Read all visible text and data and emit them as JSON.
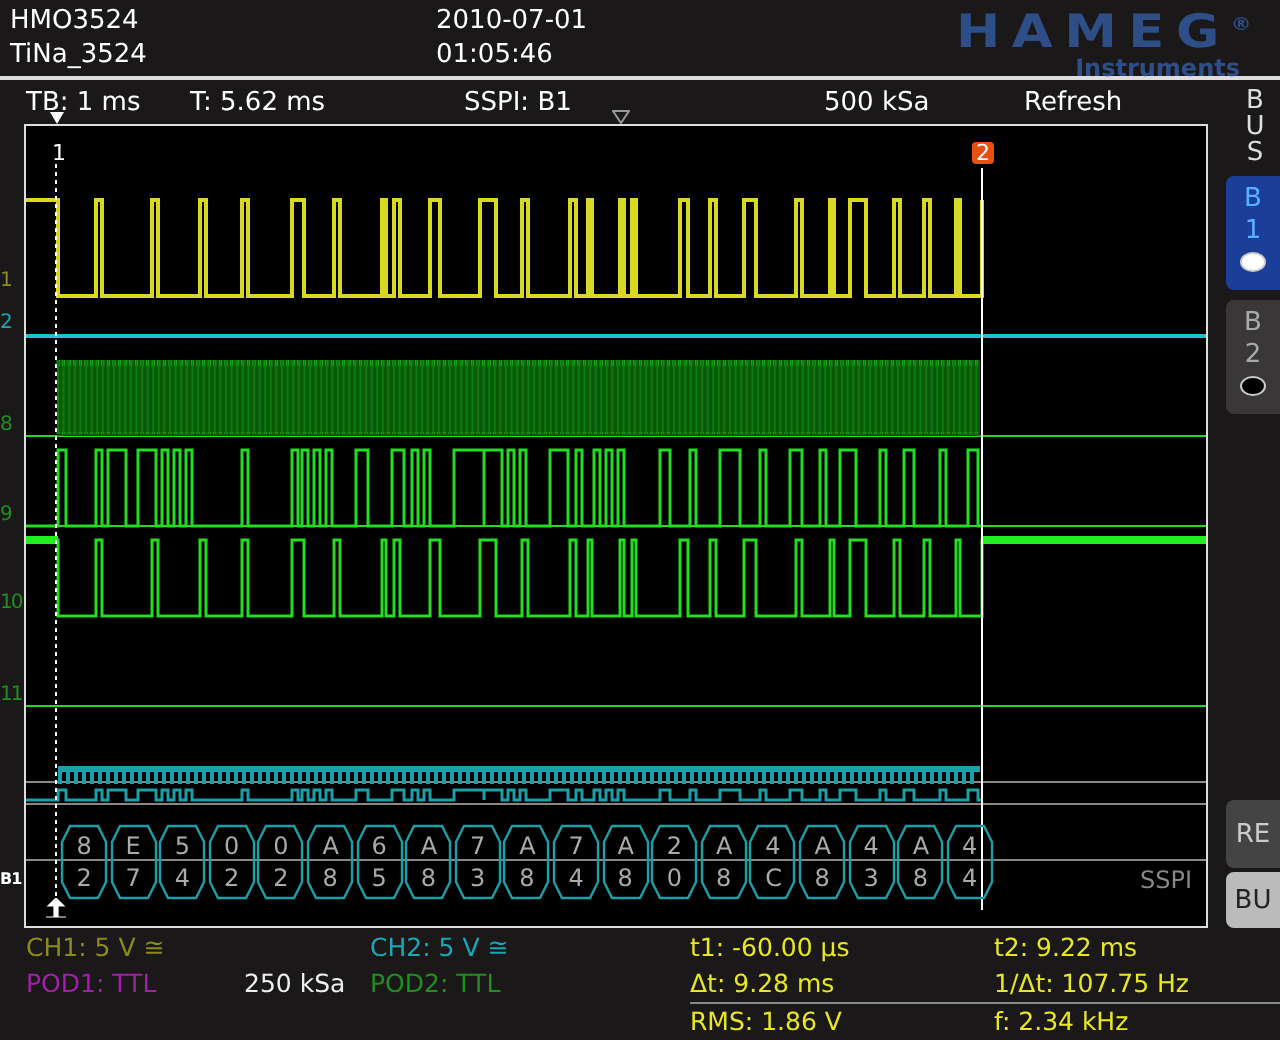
{
  "device": {
    "model": "HMO3524",
    "name": "TiNa_3524",
    "date": "2010-07-01",
    "time": "01:05:46"
  },
  "logo": {
    "name": "HAMEG$^{®}$",
    "subtitle": "Instruments"
  },
  "info_bar": [
    "TB: 1 ms",
    "T: 5.62 ms",
    "SSPI: B1",
    "500 kSa",
    "Refresh"
  ],
  "display": {
    "cursors": [
      {
        "label": "1",
        "selected": false
      },
      {
        "label": "2",
        "selected": true
      }
    ],
    "channel_markers": [
      {
        "label": "1",
        "color": "#8c8c1c"
      },
      {
        "label": "2",
        "color": "#1aa8b8"
      },
      {
        "label": "8",
        "color": "#1f8f1f"
      },
      {
        "label": "9",
        "color": "#1f8f1f"
      },
      {
        "label": "10",
        "color": "#1f8f1f"
      },
      {
        "label": "11",
        "color": "#1f8f1f"
      },
      {
        "label": "B1",
        "color": "#ffffff"
      }
    ],
    "bus_label": "SSPI",
    "decoded_bytes": [
      "82",
      "E7",
      "54",
      "02",
      "02",
      "A8",
      "65",
      "A8",
      "73",
      "A8",
      "74",
      "A8",
      "20",
      "A8",
      "4C",
      "A8",
      "43",
      "A8",
      "44"
    ]
  },
  "sidebar": {
    "title": "BUS",
    "buses": [
      {
        "label": "B1",
        "selected": true
      },
      {
        "label": "B2",
        "selected": false
      }
    ],
    "buttons": [
      {
        "label": "RE",
        "selected": false
      },
      {
        "label": "BU",
        "selected": true
      }
    ]
  },
  "channels": [
    {
      "text": "CH1: 5 V ≅",
      "color": "#8c8c1c"
    },
    {
      "text": "CH2: 5 V ≅",
      "color": "#1aa8b8"
    },
    {
      "text": "POD1: TTL",
      "color": "#a020a8"
    },
    {
      "text": "POD2: TTL",
      "color": "#1f8f1f"
    }
  ],
  "sample_rate": "250 kSa",
  "measurements": [
    "t1: -60.00 µs",
    "t2: 9.22 ms",
    "Δt: 9.28 ms",
    "1/Δt: 107.75 Hz",
    "RMS: 1.86 V",
    "f: 2.34 kHz"
  ]
}
